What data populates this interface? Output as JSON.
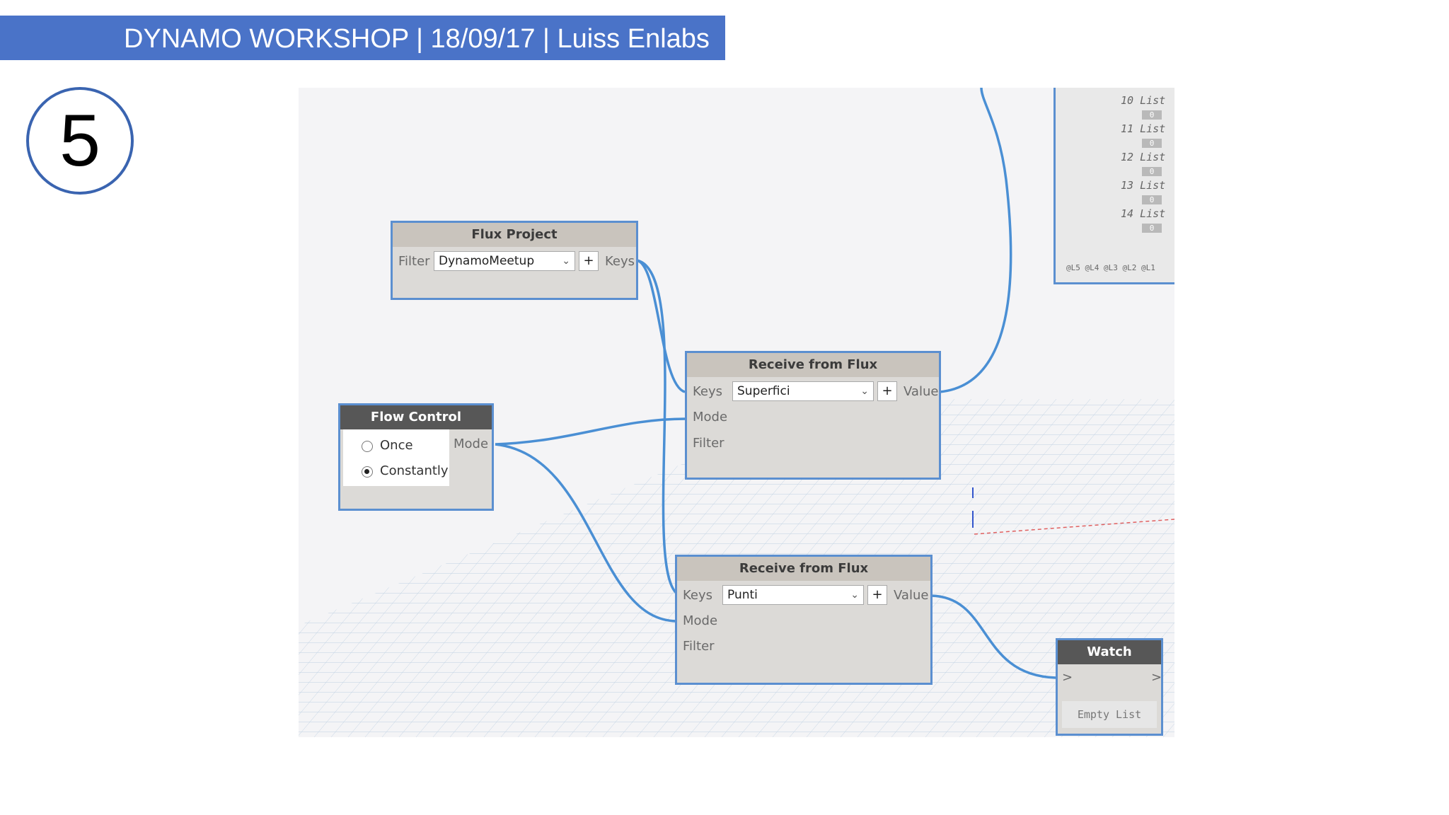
{
  "banner": {
    "title": "DYNAMO WORKSHOP | 18/09/17 | Luiss Enlabs"
  },
  "step": {
    "number": "5"
  },
  "nodes": {
    "flux_project": {
      "title": "Flux Project",
      "filter_label": "Filter",
      "filter_value": "DynamoMeetup",
      "plus": "+",
      "output": "Keys"
    },
    "flow_control": {
      "title": "Flow Control",
      "options": [
        "Once",
        "Constantly"
      ],
      "selected": "Constantly",
      "output": "Mode"
    },
    "receive_superfici": {
      "title": "Receive from Flux",
      "inputs": [
        "Keys",
        "Mode",
        "Filter"
      ],
      "key_value": "Superfici",
      "plus": "+",
      "output": "Value"
    },
    "receive_punti": {
      "title": "Receive from Flux",
      "inputs": [
        "Keys",
        "Mode",
        "Filter"
      ],
      "key_value": "Punti",
      "plus": "+",
      "output": "Value"
    },
    "watch": {
      "title": "Watch",
      "input": ">",
      "output": ">",
      "content": "Empty List"
    }
  },
  "list_panel": {
    "rows": [
      "10 List",
      "11 List",
      "12 List",
      "13 List",
      "14 List"
    ],
    "zero": "0",
    "levels": "@L5 @L4 @L3 @L2 @L1"
  },
  "colors": {
    "banner": "#4a73c8",
    "wire": "#4a8fd4",
    "node_border": "#5b8fd0"
  }
}
